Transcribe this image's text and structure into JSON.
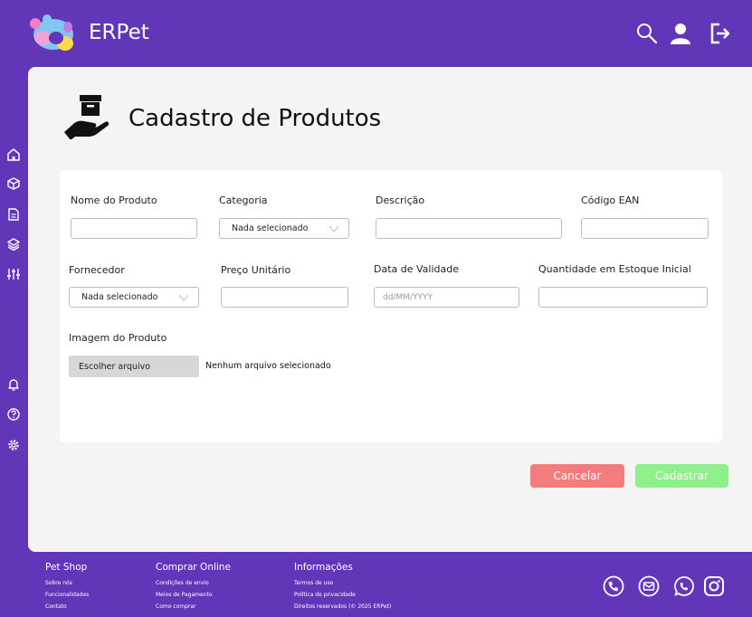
{
  "app": {
    "brand": "ERPet",
    "colors": {
      "primary": "#6136b9",
      "cancel": "#f37c7c",
      "submit": "#8ef08a"
    }
  },
  "header": {
    "icons": [
      "search-icon",
      "user-icon",
      "logout-icon"
    ]
  },
  "sidebar": {
    "top_items": [
      "home-icon",
      "box-icon",
      "document-icon",
      "layers-icon",
      "sliders-icon"
    ],
    "bottom_items": [
      "bell-icon",
      "help-icon",
      "settings-icon"
    ]
  },
  "page": {
    "title": "Cadastro de Produtos",
    "icon": "box-in-hand-icon"
  },
  "form": {
    "nome": {
      "label": "Nome do Produto",
      "value": ""
    },
    "categoria": {
      "label": "Categoria",
      "selected": "Nada selecionado"
    },
    "descricao": {
      "label": "Descrição",
      "value": ""
    },
    "ean": {
      "label": "Código EAN",
      "value": ""
    },
    "fornecedor": {
      "label": "Fornecedor",
      "selected": "Nada selecionado"
    },
    "preco": {
      "label": "Preço Unitário",
      "value": ""
    },
    "validade": {
      "label": "Data de Validade",
      "placeholder": "dd/MM/YYYY"
    },
    "estoque": {
      "label": "Quantidade em Estoque Inicial",
      "value": ""
    },
    "imagem": {
      "label": "Imagem do Produto",
      "button": "Escolher arquivo",
      "status": "Nenhum arquivo selecionado"
    }
  },
  "actions": {
    "cancel": "Cancelar",
    "submit": "Cadastrar"
  },
  "footer": {
    "col1": {
      "title": "Pet Shop",
      "links": [
        "Sobre nós",
        "Funcionalidades",
        "Contato"
      ]
    },
    "col2": {
      "title": "Comprar Online",
      "links": [
        "Condições de envio",
        "Meios de Pagamento",
        "Como comprar"
      ]
    },
    "col3": {
      "title": "Informações",
      "links": [
        "Termos de uso",
        "Política de privacidade",
        "Direitos reservados (© 2025 ERPet)"
      ]
    },
    "social": [
      "phone-icon",
      "email-icon",
      "whatsapp-icon",
      "instagram-icon"
    ]
  }
}
